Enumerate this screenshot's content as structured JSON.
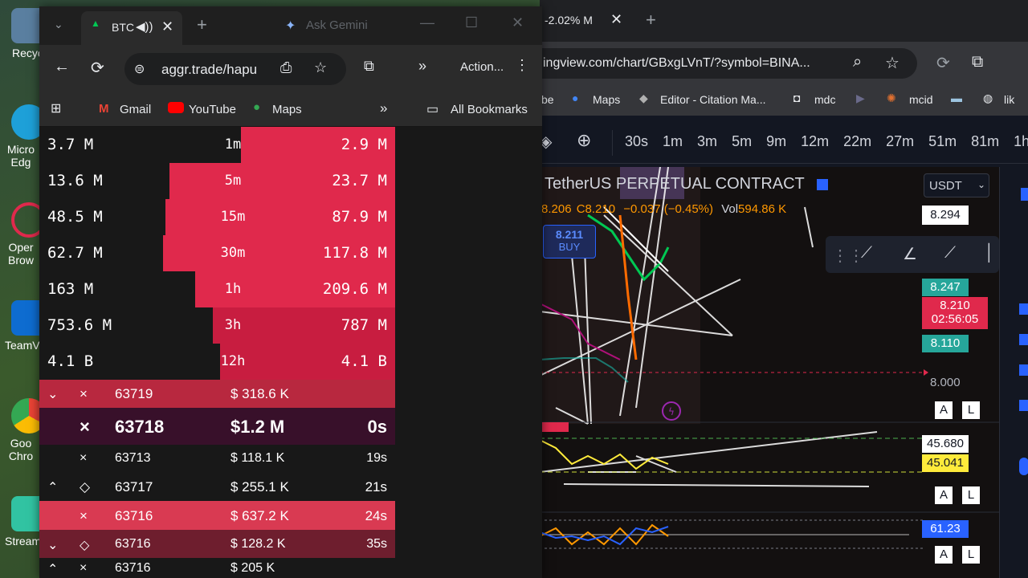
{
  "desktop": {
    "icons": [
      {
        "label": "Recycl"
      },
      {
        "label": "Micro Edg"
      },
      {
        "label": "Oper Brow"
      },
      {
        "label": "TeamV"
      },
      {
        "label": "Goo Chro"
      },
      {
        "label": "Stream"
      }
    ]
  },
  "aggr": {
    "tab_title": "BTC",
    "gemini": "Ask Gemini",
    "url": "aggr.trade/hapu",
    "action_label": "Action...",
    "bookmarks": [
      "Gmail",
      "YouTube",
      "Maps"
    ],
    "all_bookmarks": "All Bookmarks",
    "volume_rows": [
      {
        "left": "3.7 M",
        "period": "1m",
        "right": "2.9 M"
      },
      {
        "left": "13.6 M",
        "period": "5m",
        "right": "23.7 M"
      },
      {
        "left": "48.5 M",
        "period": "15m",
        "right": "87.9 M"
      },
      {
        "left": "62.7 M",
        "period": "30m",
        "right": "117.8 M"
      },
      {
        "left": "163 M",
        "period": "1h",
        "right": "209.6 M"
      },
      {
        "left": "753.6 M",
        "period": "3h",
        "right": "787 M"
      },
      {
        "left": "4.1 B",
        "period": "12h",
        "right": "4.1 B"
      }
    ],
    "trades": [
      {
        "price": "63719",
        "amount": "$ 318.6 K",
        "time": ""
      },
      {
        "price": "63718",
        "amount": "$1.2 M",
        "time": "0s"
      },
      {
        "price": "63713",
        "amount": "$ 118.1 K",
        "time": "19s"
      },
      {
        "price": "63717",
        "amount": "$ 255.1 K",
        "time": "21s"
      },
      {
        "price": "63716",
        "amount": "$ 637.2 K",
        "time": "24s"
      },
      {
        "price": "63716",
        "amount": "$ 128.2 K",
        "time": "35s"
      },
      {
        "price": "63716",
        "amount": "$ 205 K",
        "time": ""
      }
    ]
  },
  "tv": {
    "tab_title": "-2.02% M",
    "url": "ingview.com/chart/GBxgLVnT/?symbol=BINA...",
    "bookmarks": [
      "be",
      "Maps",
      "Editor - Citation Ma...",
      "mdc",
      "mcid",
      "lik"
    ],
    "timeframes": [
      "30s",
      "1m",
      "3m",
      "5m",
      "9m",
      "12m",
      "22m",
      "27m",
      "51m",
      "81m",
      "1h"
    ],
    "symbol_title": "TetherUS PERPETUAL CONTRACT",
    "ohlc_prefix": "8.206",
    "ohlc_c": "C8.210",
    "ohlc_change": "−0.037 (−0.45%)",
    "vol_label": "Vol",
    "vol_value": "594.86 K",
    "buy_price": "8.211",
    "buy_label": "BUY",
    "currency": "USDT",
    "price_labels": [
      "8.294",
      "8.247",
      "8.210",
      "02:56:05",
      "8.110",
      "8.000"
    ],
    "osc_labels": [
      "45.680",
      "45.041"
    ],
    "rsi_label": "61.23",
    "al_a": "A",
    "al_l": "L"
  },
  "colors": {
    "sell": "#e0294c",
    "panel": "#181818",
    "accent": "#2962ff"
  }
}
